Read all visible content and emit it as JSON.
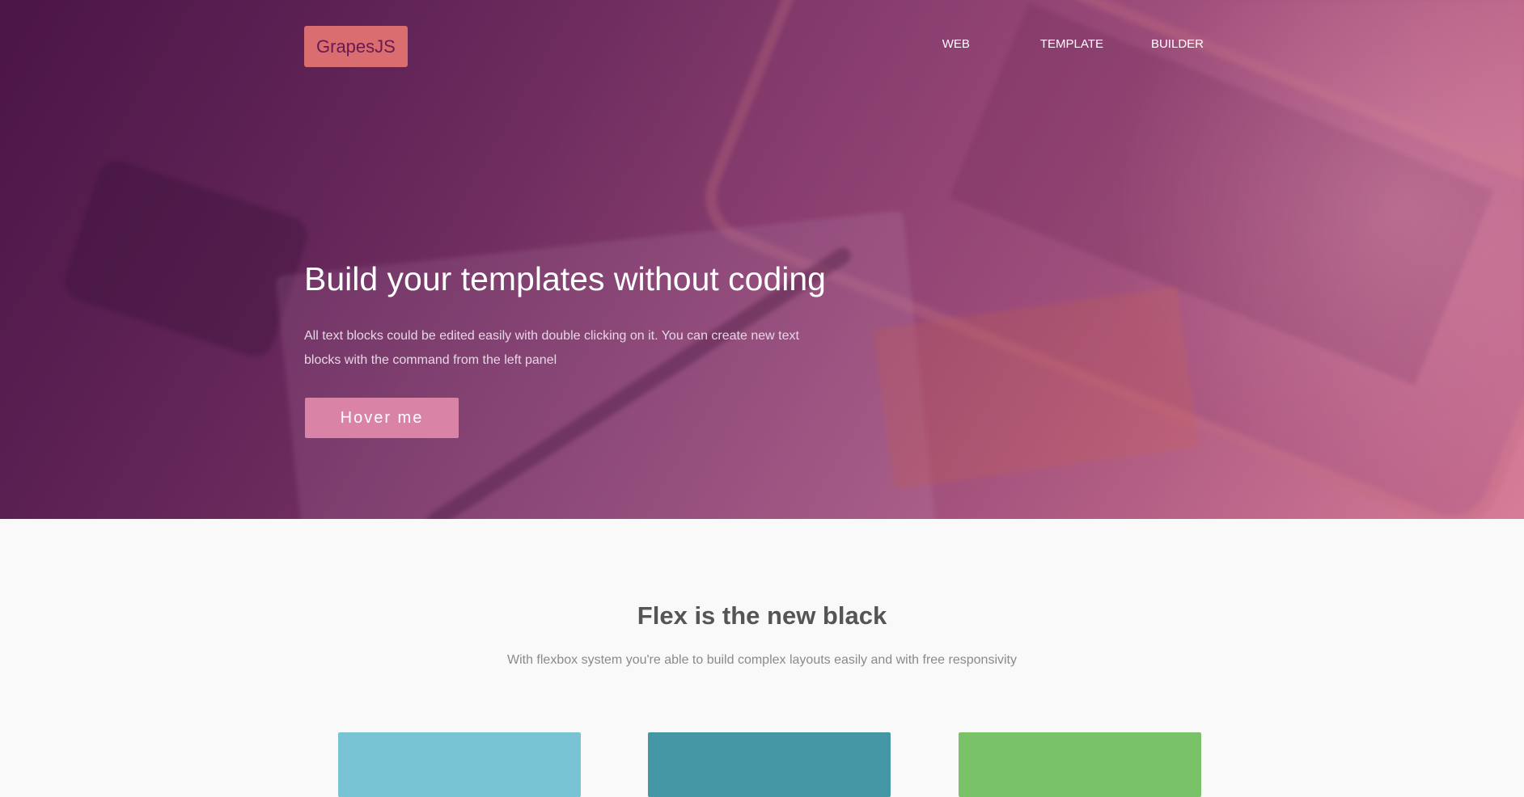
{
  "header": {
    "logo_text": "GrapesJS",
    "menu": [
      {
        "label": "WEB"
      },
      {
        "label": "TEMPLATE"
      },
      {
        "label": "BUILDER"
      }
    ]
  },
  "hero": {
    "title": "Build your templates without coding",
    "lead": "All text blocks could be edited easily with double clicking on it. You can create new text blocks with the command from the left panel",
    "button_label": "Hover me"
  },
  "flex_section": {
    "title": "Flex is the new black",
    "description": "With flexbox system you're able to build complex layouts easily and with free responsivity",
    "cards": [
      {
        "color": "#79c4d4"
      },
      {
        "color": "#4497a5"
      },
      {
        "color": "#79c267"
      }
    ]
  },
  "colors": {
    "logo_background": "#d96d70",
    "button_background": "#d983a6",
    "hero_gradient_start": "#4b1548",
    "hero_gradient_end": "#d57e98"
  }
}
